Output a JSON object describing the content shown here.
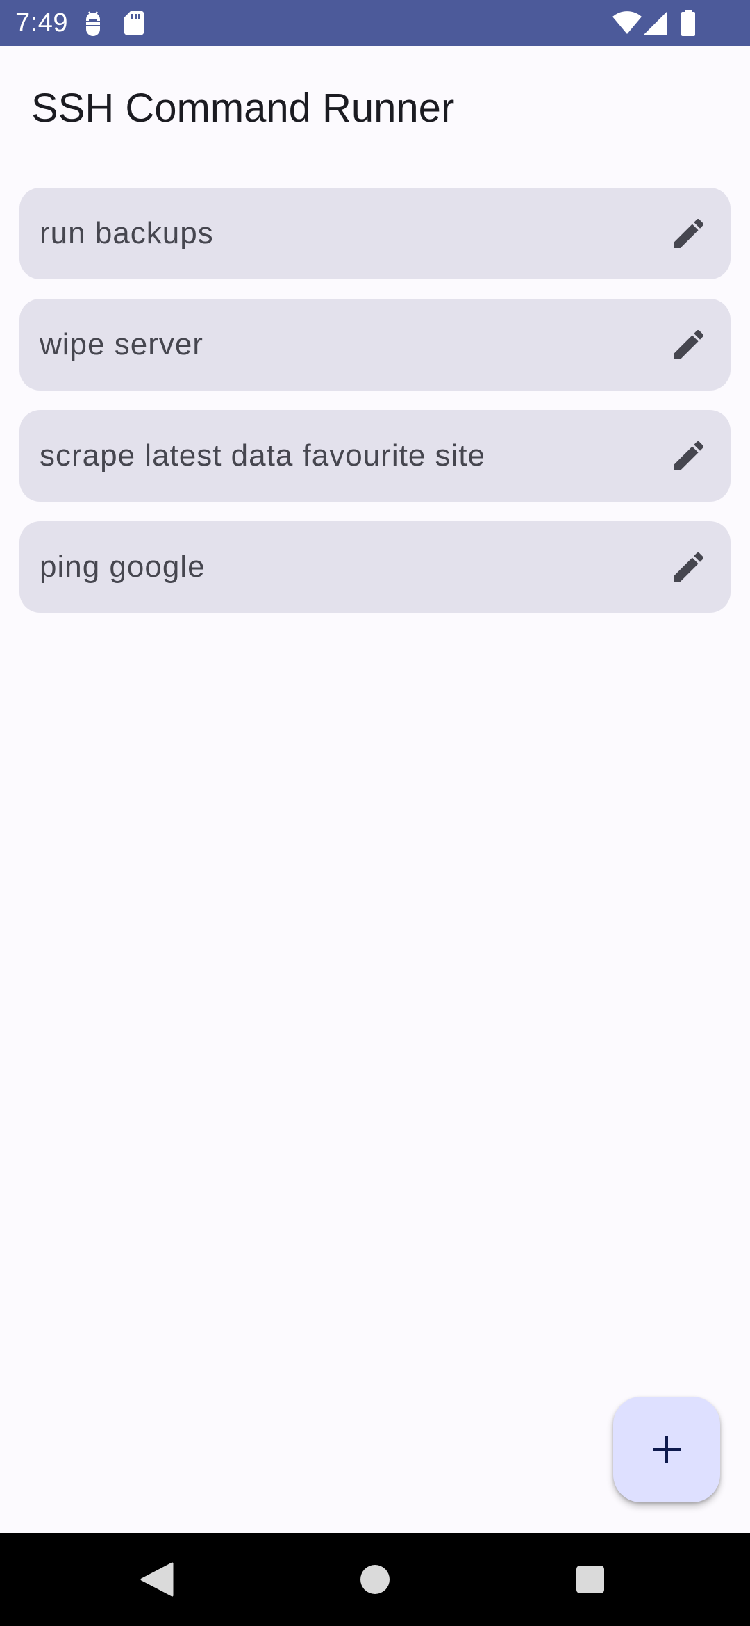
{
  "status_bar": {
    "time": "7:49",
    "left_icons": [
      "android-debug-icon",
      "sd-card-icon"
    ],
    "right_icons": [
      "wifi-icon",
      "cellular-signal-icon",
      "battery-icon"
    ],
    "background": "#4C5A9A"
  },
  "app": {
    "title": "SSH Command Runner"
  },
  "commands": [
    {
      "label": "run backups",
      "action_icon": "edit-icon"
    },
    {
      "label": "wipe server",
      "action_icon": "edit-icon"
    },
    {
      "label": "scrape latest data favourite site",
      "action_icon": "edit-icon"
    },
    {
      "label": "ping google",
      "action_icon": "edit-icon"
    }
  ],
  "fab": {
    "icon": "plus-icon"
  },
  "navigation_bar": {
    "buttons": [
      "back-icon",
      "home-icon",
      "recents-icon"
    ]
  },
  "colors": {
    "background": "#FCFAFE",
    "card": "#E3E1EC",
    "card_text": "#46464F",
    "title_text": "#1B1B21",
    "fab_background": "#DEE0FF",
    "fab_icon": "#0E1A4D"
  }
}
